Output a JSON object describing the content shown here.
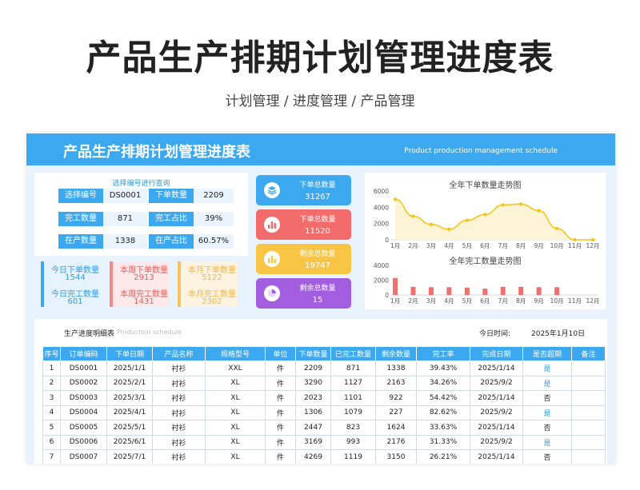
{
  "title": "产品生产排期计划管理进度表",
  "subtitle": "计划管理 / 进度管理  / 产品管理",
  "sheet": {
    "title": "产品生产排期计划管理进度表",
    "title_en": "Product production management schedule"
  },
  "info": {
    "heading": "选择编号进行查询",
    "fields": [
      {
        "label": "选择编号",
        "value": "DS0001"
      },
      {
        "label": "下单数量",
        "value": "2209"
      },
      {
        "label": "完工数量",
        "value": "871"
      },
      {
        "label": "完工占比",
        "value": "39%"
      },
      {
        "label": "在产数量",
        "value": "1338"
      },
      {
        "label": "在产占比",
        "value": "60.57%"
      }
    ]
  },
  "mini_stats": [
    {
      "label": "今日下单数量",
      "value": "1544",
      "label2": "今日完工数量",
      "value2": "601"
    },
    {
      "label": "本周下单数量",
      "value": "2913",
      "label2": "本周完工数量",
      "value2": "1431"
    },
    {
      "label": "本月下单数量",
      "value": "5122",
      "label2": "本月完工数量",
      "value2": "2302"
    }
  ],
  "summary_cards": [
    {
      "label": "下单总数量",
      "value": "31267",
      "color": "#3ba8f0",
      "icon": "stack-icon"
    },
    {
      "label": "下单总数量",
      "value": "11520",
      "color": "#f36c6c",
      "icon": "bar-chart-icon"
    },
    {
      "label": "剩余总数量",
      "value": "19747",
      "color": "#f8c545",
      "icon": "bar-chart-icon"
    },
    {
      "label": "剩余总数量",
      "value": "15",
      "color": "#a35ee0",
      "icon": "pie-chart-icon"
    }
  ],
  "chart_data": [
    {
      "type": "area",
      "title": "全年下单数量走势图",
      "categories": [
        "1月",
        "2月",
        "3月",
        "4月",
        "5月",
        "6月",
        "7月",
        "8月",
        "9月",
        "10月",
        "11月",
        "12月"
      ],
      "values": [
        5000,
        2900,
        1900,
        1300,
        2400,
        3100,
        4300,
        4400,
        3600,
        1400,
        0,
        0
      ],
      "ylim": [
        0,
        6000
      ],
      "yticks": [
        "6000",
        "4000",
        "2000",
        "0"
      ],
      "color": "#f5c518"
    },
    {
      "type": "bar",
      "title": "全年完工数量走势图",
      "categories": [
        "1月",
        "2月",
        "3月",
        "4月",
        "5月",
        "6月",
        "7月",
        "8月",
        "9月",
        "10月",
        "11月",
        "12月"
      ],
      "values": [
        2300,
        1100,
        1050,
        1050,
        1000,
        850,
        1100,
        1100,
        1050,
        1050,
        0,
        0
      ],
      "ylim": [
        0,
        4000
      ],
      "yticks": [
        "4000",
        "2000",
        "0"
      ],
      "color": "#f07070"
    }
  ],
  "table": {
    "title": "生产进度明细表",
    "title_en": "Production schedule",
    "date_label": "今日时间:",
    "date_value": "2025年1月10日",
    "headers": [
      "序号",
      "订单编码",
      "下单日期",
      "产品名称",
      "规格型号",
      "单位",
      "下单数量",
      "已完工数量",
      "剩余数量",
      "完工率",
      "完成日期",
      "是否超期",
      "备注"
    ],
    "rows": [
      [
        "1",
        "DS0001",
        "2025/1/1",
        "衬衫",
        "XXL",
        "件",
        "2209",
        "871",
        "1338",
        "39.43%",
        "2025/1/14",
        "是",
        ""
      ],
      [
        "2",
        "DS0002",
        "2025/2/1",
        "衬衫",
        "XL",
        "件",
        "3290",
        "1127",
        "2163",
        "34.26%",
        "2025/9/2",
        "是",
        ""
      ],
      [
        "3",
        "DS0003",
        "2025/3/1",
        "衬衫",
        "XL",
        "件",
        "2023",
        "1101",
        "922",
        "54.42%",
        "2025/1/14",
        "否",
        ""
      ],
      [
        "4",
        "DS0004",
        "2025/4/1",
        "衬衫",
        "XL",
        "件",
        "1306",
        "1079",
        "227",
        "82.62%",
        "2025/9/2",
        "是",
        ""
      ],
      [
        "5",
        "DS0005",
        "2025/5/1",
        "衬衫",
        "XL",
        "件",
        "2447",
        "823",
        "1624",
        "33.63%",
        "2025/1/14",
        "否",
        ""
      ],
      [
        "6",
        "DS0006",
        "2025/6/1",
        "衬衫",
        "XL",
        "件",
        "3169",
        "993",
        "2176",
        "31.33%",
        "2025/9/2",
        "是",
        ""
      ],
      [
        "7",
        "DS0007",
        "2025/7/1",
        "衬衫",
        "XL",
        "件",
        "4269",
        "1119",
        "3150",
        "26.21%",
        "2025/1/14",
        "否",
        ""
      ]
    ]
  }
}
